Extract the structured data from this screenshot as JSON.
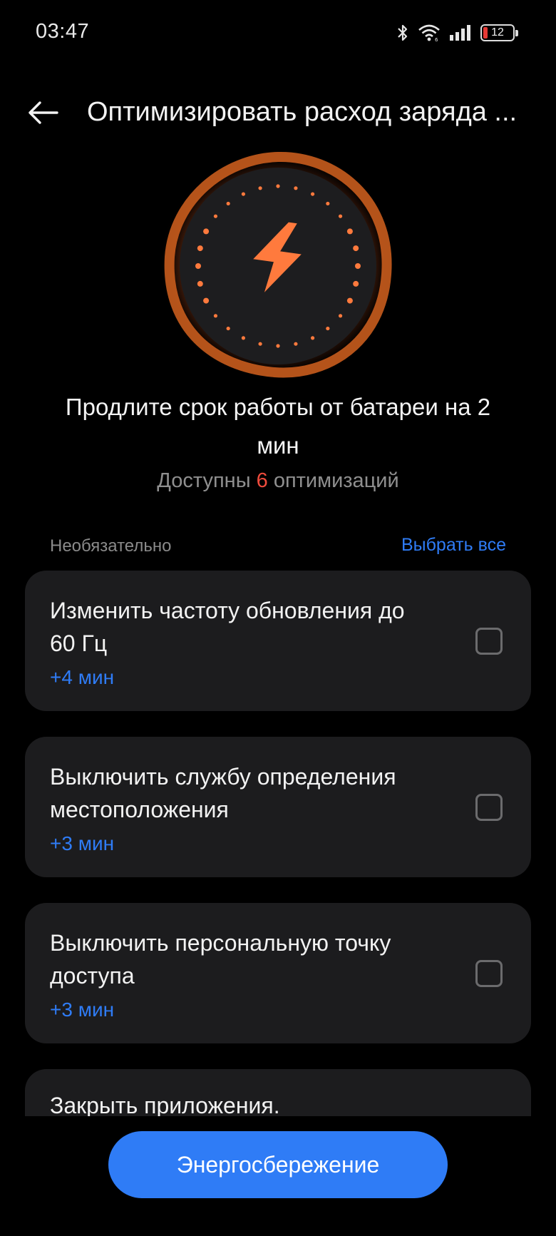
{
  "status_bar": {
    "time": "03:47",
    "icons": [
      "bluetooth-icon",
      "wifi-icon",
      "signal-icon",
      "battery-icon"
    ],
    "battery_level": "12",
    "battery_color": "#e53935"
  },
  "header": {
    "back_icon": "arrow-left-icon",
    "title": "Оптимизировать расход заряда ..."
  },
  "hero": {
    "icon": "lightning-bolt-icon",
    "accent_color": "#ff7a3d"
  },
  "summary": {
    "headline": "Продлите срок работы от батареи на 2 мин",
    "available_prefix": "Доступны",
    "available_count": "6",
    "available_suffix": "оптимизаций"
  },
  "section": {
    "label": "Необязательно",
    "select_all": "Выбрать все"
  },
  "optimizations": [
    {
      "title": "Изменить частоту обновления до 60 Гц",
      "gain": "+4 мин",
      "checked": false
    },
    {
      "title": "Выключить службу определения местоположения",
      "gain": "+3 мин",
      "checked": false
    },
    {
      "title": "Выключить персональную точку доступа",
      "gain": "+3 мин",
      "checked": false
    },
    {
      "title": "Закрыть приложения."
    }
  ],
  "primary_button": {
    "label": "Энергосбережение",
    "color": "#2f7cf6"
  }
}
